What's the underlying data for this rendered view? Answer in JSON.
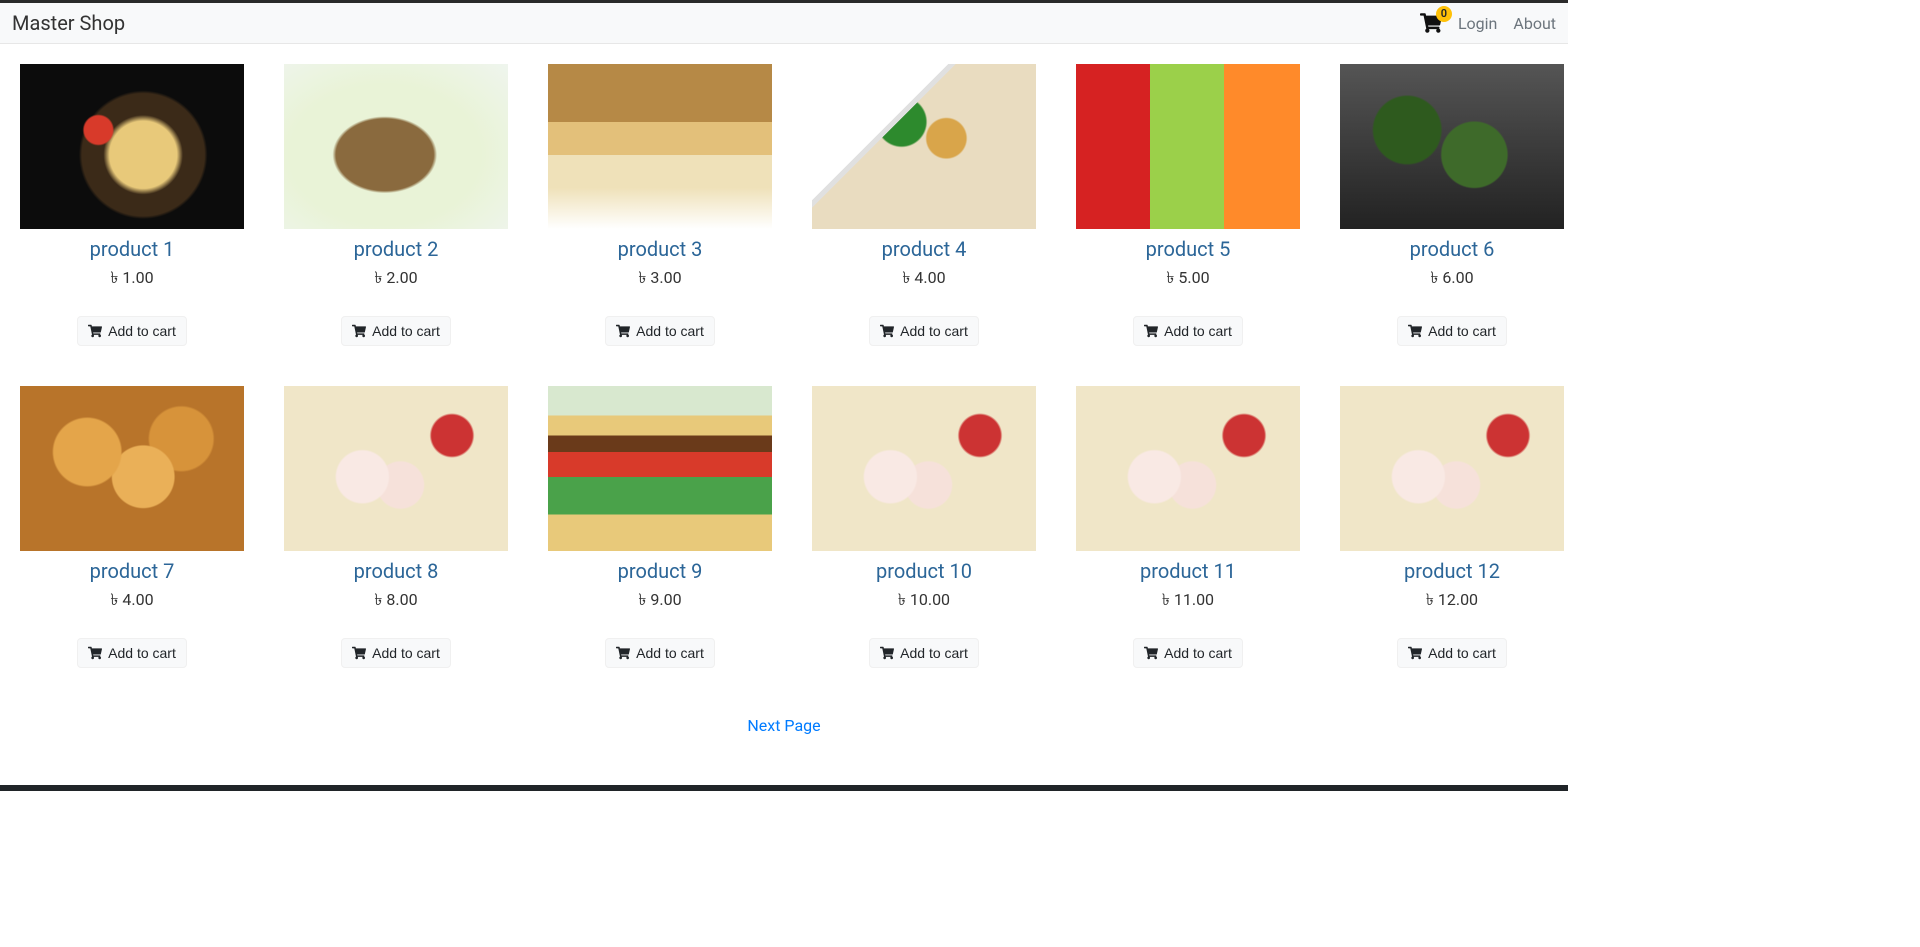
{
  "navbar": {
    "brand": "Master Shop",
    "cart_count": "0",
    "login": "Login",
    "about": "About"
  },
  "labels": {
    "add_to_cart": "Add to cart"
  },
  "pager": {
    "next": "Next Page"
  },
  "products": [
    {
      "name": "product 1",
      "price": "৳ 1.00",
      "img_class": "f1"
    },
    {
      "name": "product 2",
      "price": "৳ 2.00",
      "img_class": "f2"
    },
    {
      "name": "product 3",
      "price": "৳ 3.00",
      "img_class": "f3"
    },
    {
      "name": "product 4",
      "price": "৳ 4.00",
      "img_class": "f4"
    },
    {
      "name": "product 5",
      "price": "৳ 5.00",
      "img_class": "f5"
    },
    {
      "name": "product 6",
      "price": "৳ 6.00",
      "img_class": "f6"
    },
    {
      "name": "product 7",
      "price": "৳ 4.00",
      "img_class": "f7"
    },
    {
      "name": "product 8",
      "price": "৳ 8.00",
      "img_class": "f8"
    },
    {
      "name": "product 9",
      "price": "৳ 9.00",
      "img_class": "f9"
    },
    {
      "name": "product 10",
      "price": "৳ 10.00",
      "img_class": "f8"
    },
    {
      "name": "product 11",
      "price": "৳ 11.00",
      "img_class": "f8"
    },
    {
      "name": "product 12",
      "price": "৳ 12.00",
      "img_class": "f8"
    }
  ]
}
